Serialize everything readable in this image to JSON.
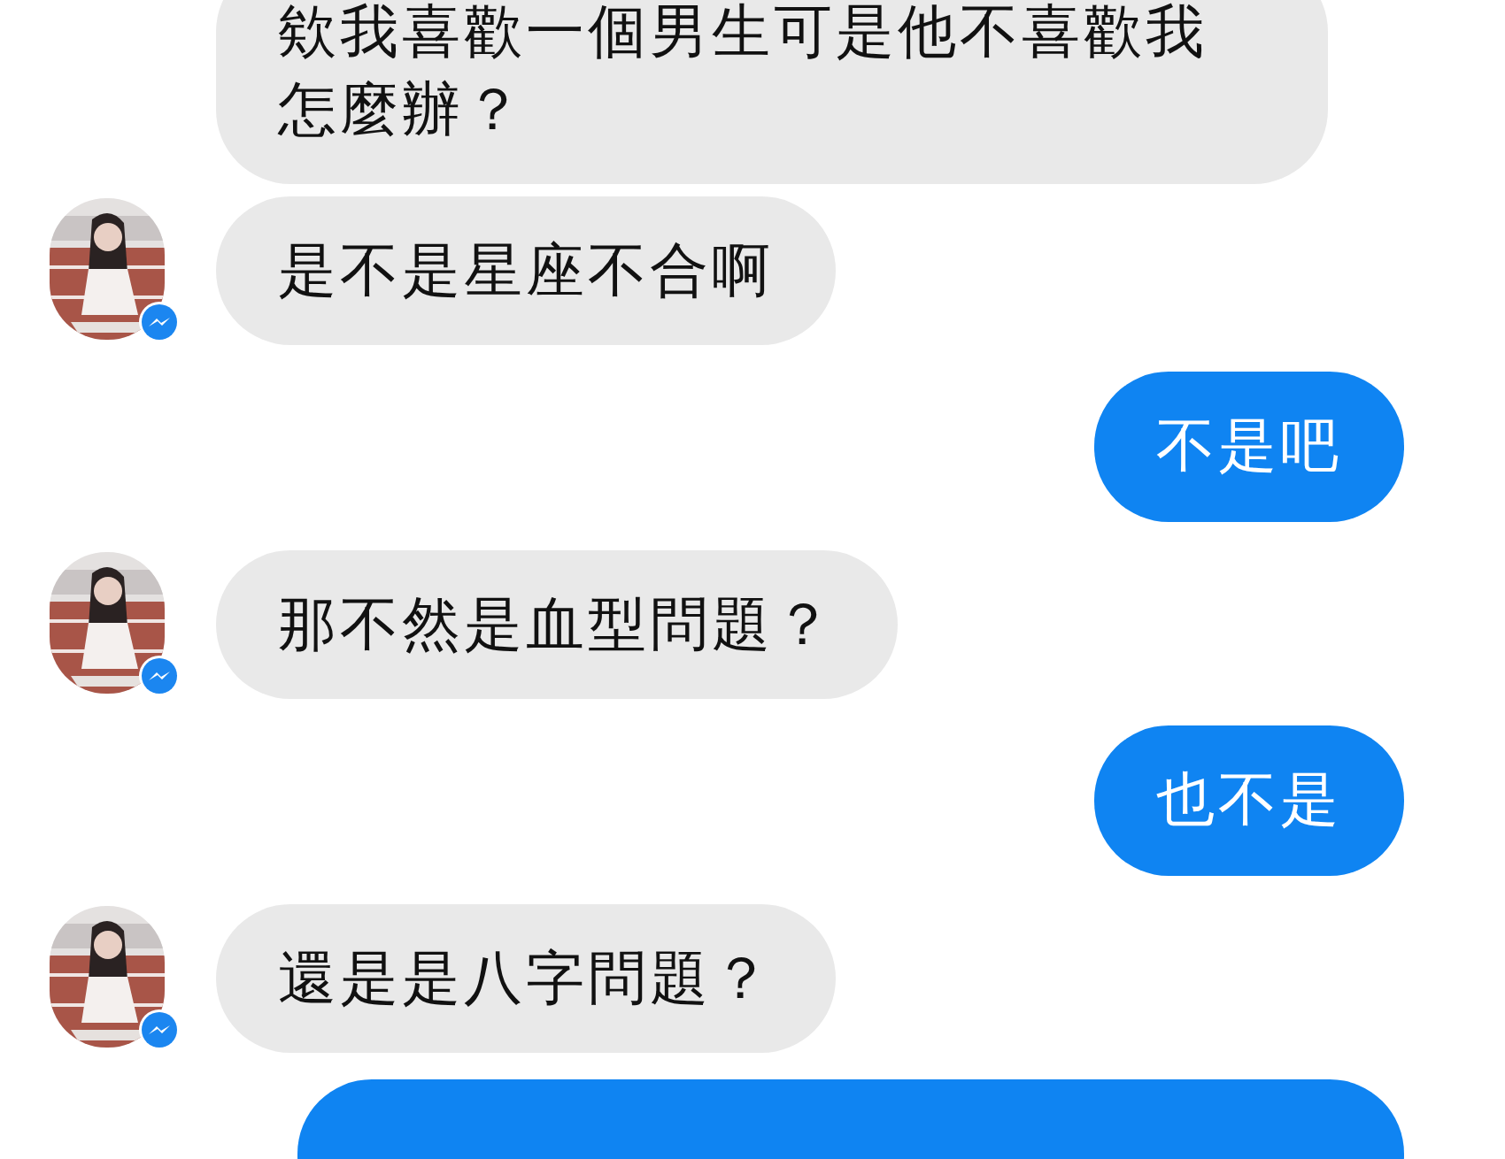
{
  "messages": [
    {
      "kind": "incoming",
      "text": "欸我喜歡一個男生可是他不喜歡我怎麼辦？",
      "avatar": false
    },
    {
      "kind": "incoming",
      "text": "是不是星座不合啊",
      "avatar": true
    },
    {
      "kind": "outgoing",
      "text": "不是吧"
    },
    {
      "kind": "incoming",
      "text": "那不然是血型問題？",
      "avatar": true
    },
    {
      "kind": "outgoing",
      "text": "也不是"
    },
    {
      "kind": "incoming",
      "text": "還是是八字問題？",
      "avatar": true
    },
    {
      "kind": "outgoing"
    }
  ]
}
